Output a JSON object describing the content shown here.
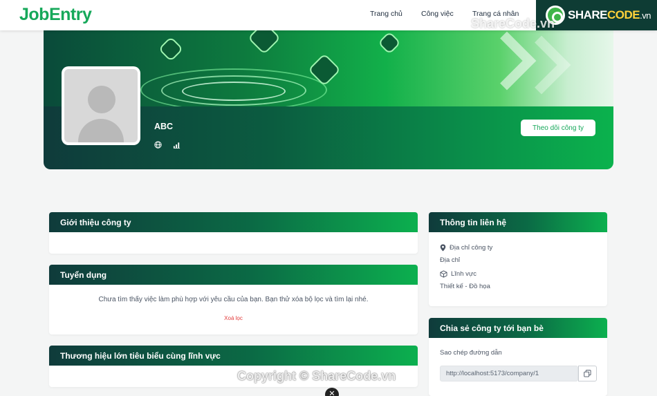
{
  "header": {
    "logo": "JobEntry",
    "nav": [
      "Trang chủ",
      "Công việc",
      "Trang cá nhân"
    ]
  },
  "watermark": {
    "badge_share": "SHARE",
    "badge_code": "CODE",
    "badge_tld": ".vn",
    "overlay_top": "ShareCode.vn",
    "overlay_bottom": "Copyright © ShareCode.vn"
  },
  "profile": {
    "company_name": "ABC",
    "follow_label": "Theo dõi công ty",
    "icons": [
      "globe-icon",
      "signal-bars-icon"
    ]
  },
  "sections": {
    "intro_title": "Giới thiệu công ty",
    "recruit_title": "Tuyển dụng",
    "recruit_empty": "Chưa tìm thấy việc làm phù hợp với yêu cầu của bạn. Bạn thử xóa bộ lọc và tìm lại nhé.",
    "recruit_clear": "Xoá lọc",
    "brands_title": "Thương hiệu lớn tiêu biểu cùng lĩnh vực"
  },
  "contact": {
    "title": "Thông tin liên hệ",
    "address_label": "Địa chỉ công ty",
    "address_value": "Địa chỉ",
    "field_label": "Lĩnh vực",
    "field_value": "Thiết kế - Đồ họa"
  },
  "share": {
    "title": "Chia sẻ công ty tới bạn bè",
    "copy_label": "Sao chép đường dẫn",
    "url": "http://localhost:5173/company/1"
  },
  "colors": {
    "brand": "#16a85a",
    "header_gradient_start": "#0f3b3b",
    "header_gradient_end": "#0cb04f",
    "danger": "#e23b3b"
  }
}
